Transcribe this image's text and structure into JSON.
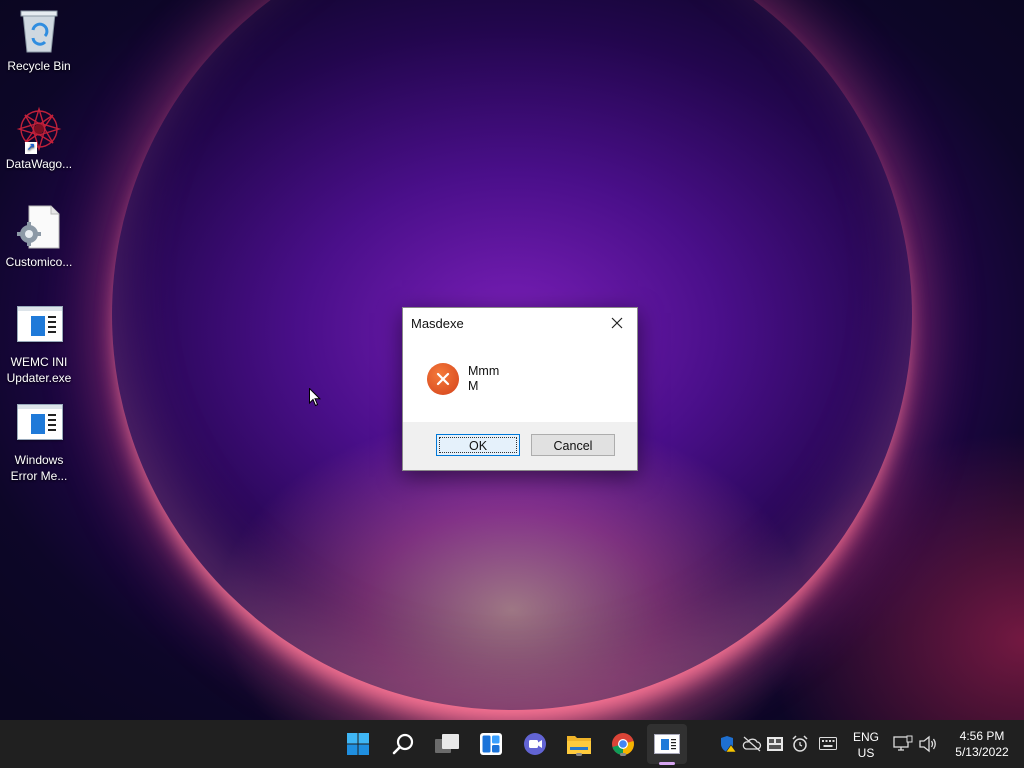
{
  "desktop": {
    "icons": [
      {
        "name": "recycle-bin",
        "label": "Recycle Bin"
      },
      {
        "name": "datawagon",
        "label": "DataWago..."
      },
      {
        "name": "customico",
        "label": "Customico..."
      },
      {
        "name": "wemc-ini-updater",
        "label": "WEMC INI\nUpdater.exe"
      },
      {
        "name": "windows-error-messages",
        "label": "Windows\nError Me..."
      }
    ]
  },
  "dialog": {
    "title": "Masdexe",
    "message_line1": "Mmm",
    "message_line2": "M",
    "ok_label": "OK",
    "cancel_label": "Cancel",
    "icon": "error-icon",
    "icon_color": "#e05a28"
  },
  "taskbar": {
    "apps": [
      "start-icon",
      "search-icon",
      "task-view-icon",
      "widgets-icon",
      "teams-chat-icon",
      "file-explorer-icon",
      "chrome-icon",
      "active-app-icon"
    ],
    "tray": {
      "language_line1": "ENG",
      "language_line2": "US",
      "time": "4:56 PM",
      "date": "5/13/2022"
    }
  }
}
